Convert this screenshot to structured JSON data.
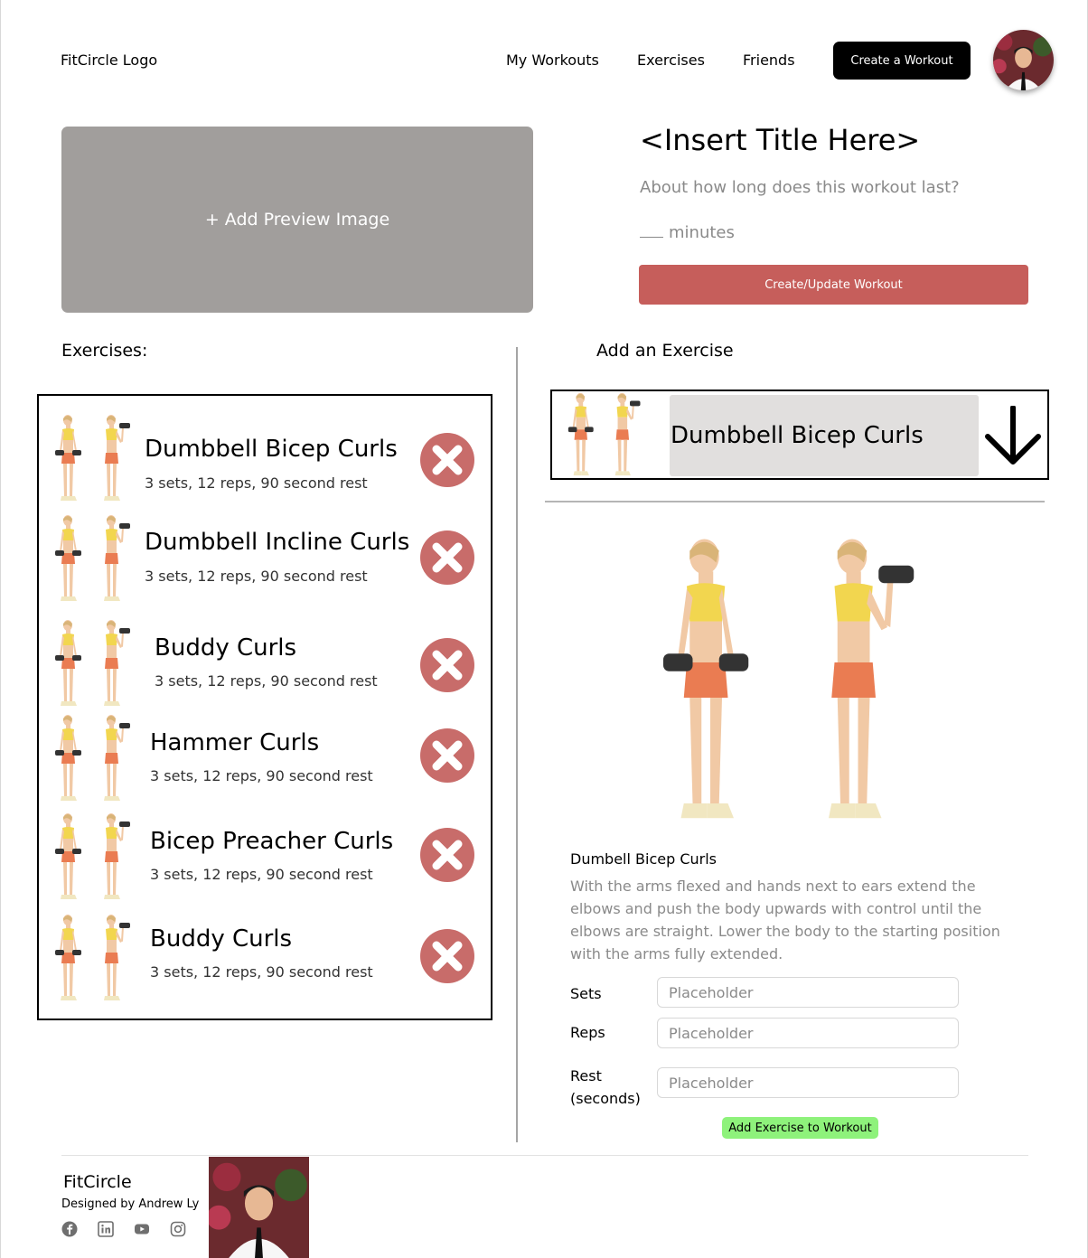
{
  "header": {
    "logo": "FitCircle Logo",
    "nav": [
      "My Workouts",
      "Exercises",
      "Friends"
    ],
    "create_button": "Create a Workout"
  },
  "workout": {
    "preview_label": "+ Add Preview Image",
    "title": "<Insert Title Here>",
    "duration_question": "About how long does this workout last?",
    "minutes_label": "minutes",
    "update_button": "Create/Update Workout"
  },
  "exercises": {
    "heading": "Exercises:",
    "items": [
      {
        "name": "Dumbbell Bicep Curls",
        "detail": "3 sets, 12 reps, 90 second rest"
      },
      {
        "name": "Dumbbell Incline Curls",
        "detail": "3 sets, 12 reps, 90 second rest"
      },
      {
        "name": "Buddy Curls",
        "detail": "3 sets, 12 reps, 90 second rest"
      },
      {
        "name": "Hammer Curls",
        "detail": "3 sets, 12 reps, 90 second rest"
      },
      {
        "name": "Bicep Preacher Curls",
        "detail": "3 sets, 12 reps, 90 second rest"
      },
      {
        "name": "Buddy Curls",
        "detail": "3 sets, 12 reps, 90 second rest"
      }
    ]
  },
  "add_exercise": {
    "heading": "Add an Exercise",
    "selected": "Dumbbell Bicep Curls",
    "detail_title": "Dumbell Bicep Curls",
    "description": "With the arms flexed and hands next to ears extend the elbows and push the body upwards with control until the elbows are straight. Lower the body to the starting position with the arms fully extended.",
    "sets_label": "Sets",
    "reps_label": "Reps",
    "rest_label_1": "Rest",
    "rest_label_2": "(seconds)",
    "sets_placeholder": "Placeholder",
    "reps_placeholder": "Placeholder",
    "rest_placeholder": "Placeholder",
    "add_button": "Add Exercise to Workout"
  },
  "footer": {
    "brand": "FitCircle",
    "credit": "Designed by Andrew Ly",
    "social_icons": [
      "facebook-icon",
      "linkedin-icon",
      "youtube-icon",
      "instagram-icon"
    ]
  },
  "colors": {
    "update_button": "#c65e5b",
    "remove_icon": "#c86c6a",
    "add_button": "#8ef27b",
    "preview_bg": "#a19e9c"
  }
}
